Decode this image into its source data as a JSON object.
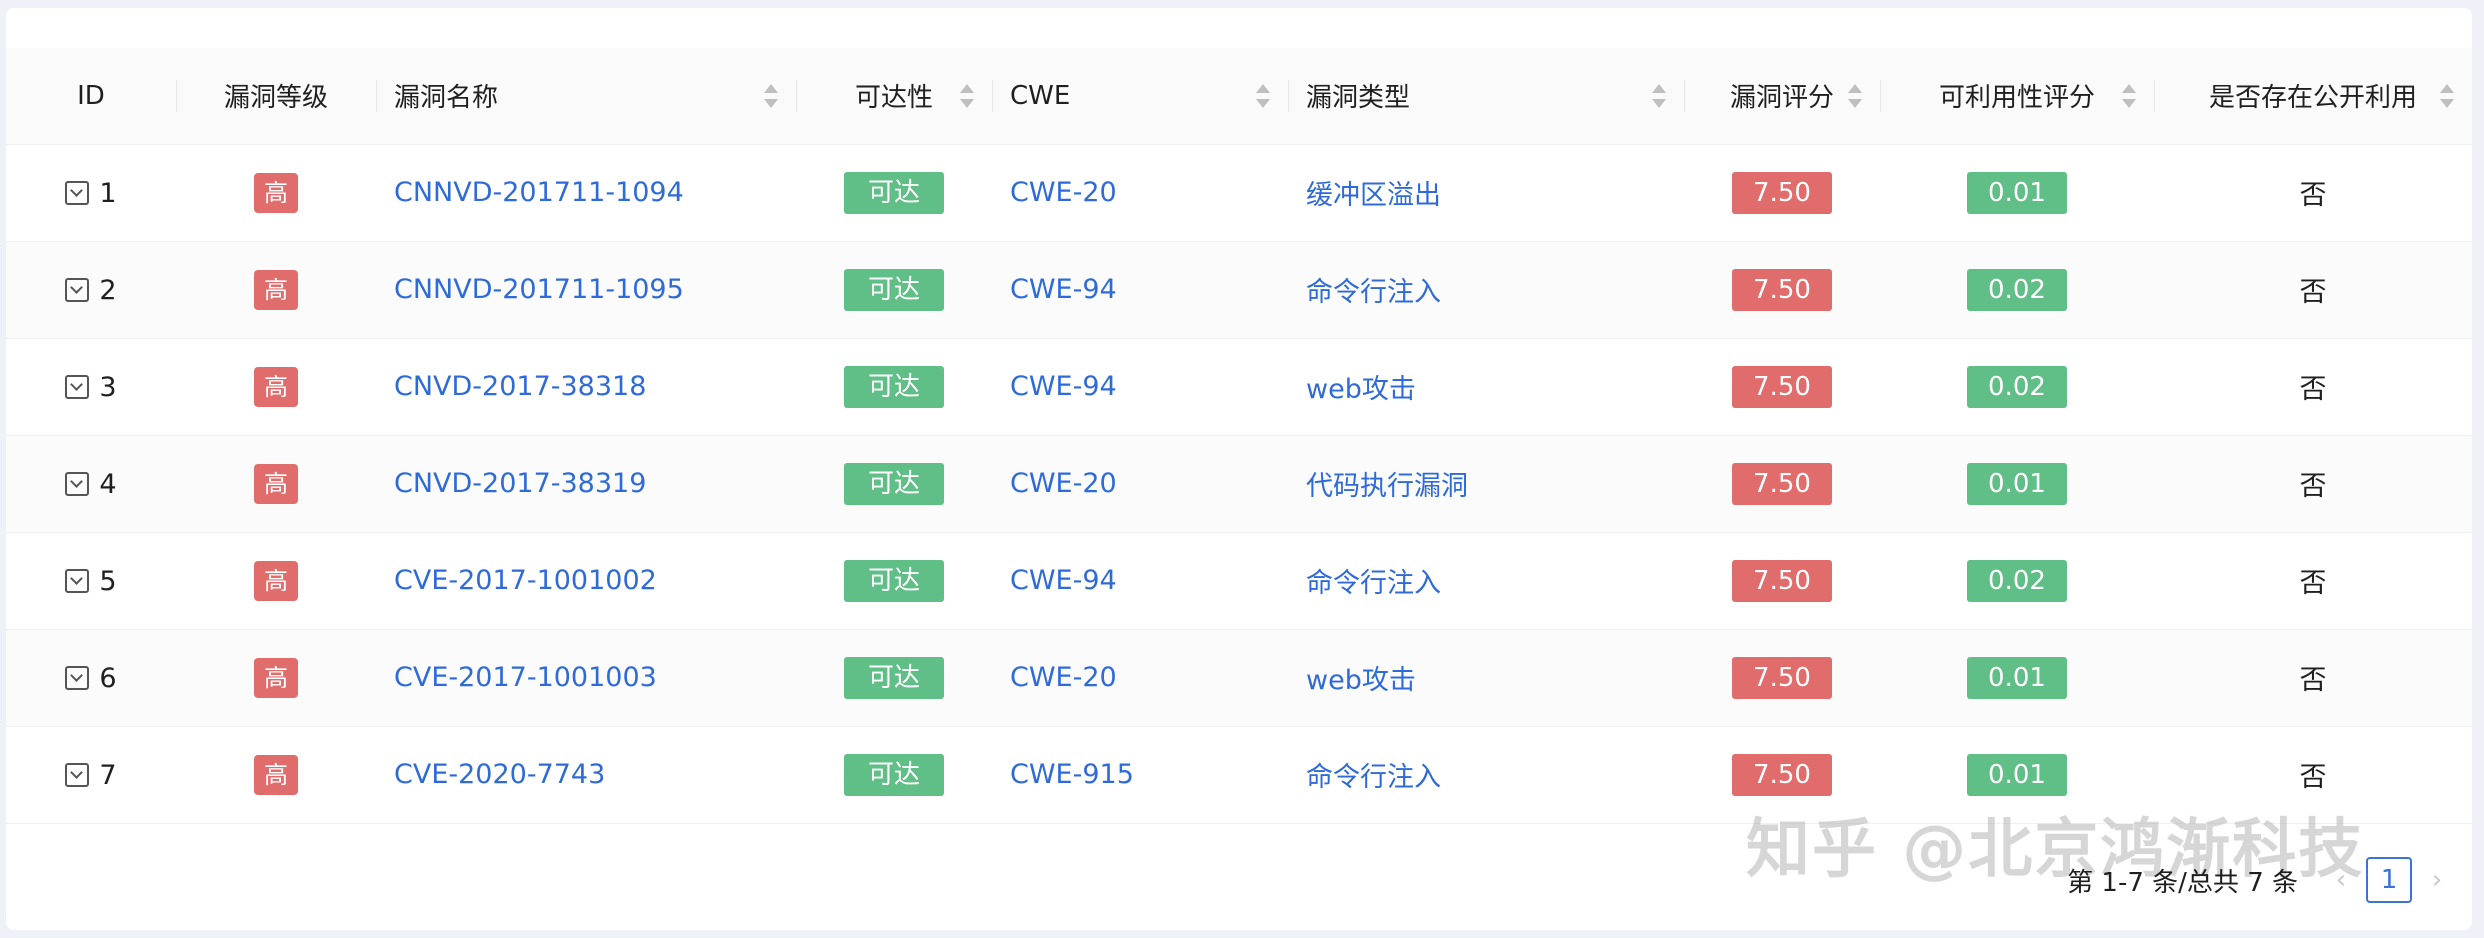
{
  "columns": {
    "id": "ID",
    "level": "漏洞等级",
    "name": "漏洞名称",
    "reach": "可达性",
    "cwe": "CWE",
    "type": "漏洞类型",
    "score": "漏洞评分",
    "exploit_score": "可利用性评分",
    "public": "是否存在公开利用"
  },
  "rows": [
    {
      "id": "1",
      "level": "高",
      "name": "CNNVD-201711-1094",
      "reach": "可达",
      "cwe": "CWE-20",
      "type": "缓冲区溢出",
      "score": "7.50",
      "exploit_score": "0.01",
      "public": "否"
    },
    {
      "id": "2",
      "level": "高",
      "name": "CNNVD-201711-1095",
      "reach": "可达",
      "cwe": "CWE-94",
      "type": "命令行注入",
      "score": "7.50",
      "exploit_score": "0.02",
      "public": "否"
    },
    {
      "id": "3",
      "level": "高",
      "name": "CNVD-2017-38318",
      "reach": "可达",
      "cwe": "CWE-94",
      "type": "web攻击",
      "score": "7.50",
      "exploit_score": "0.02",
      "public": "否"
    },
    {
      "id": "4",
      "level": "高",
      "name": "CNVD-2017-38319",
      "reach": "可达",
      "cwe": "CWE-20",
      "type": "代码执行漏洞",
      "score": "7.50",
      "exploit_score": "0.01",
      "public": "否"
    },
    {
      "id": "5",
      "level": "高",
      "name": "CVE-2017-1001002",
      "reach": "可达",
      "cwe": "CWE-94",
      "type": "命令行注入",
      "score": "7.50",
      "exploit_score": "0.02",
      "public": "否"
    },
    {
      "id": "6",
      "level": "高",
      "name": "CVE-2017-1001003",
      "reach": "可达",
      "cwe": "CWE-20",
      "type": "web攻击",
      "score": "7.50",
      "exploit_score": "0.01",
      "public": "否"
    },
    {
      "id": "7",
      "level": "高",
      "name": "CVE-2020-7743",
      "reach": "可达",
      "cwe": "CWE-915",
      "type": "命令行注入",
      "score": "7.50",
      "exploit_score": "0.01",
      "public": "否"
    }
  ],
  "pagination": {
    "total_text": "第 1-7 条/总共 7 条",
    "current_page": "1",
    "prev_icon": "‹",
    "next_icon": "›"
  },
  "watermark": "知乎 @北京鸿渐科技",
  "icons": {
    "expand": "expand-row-icon",
    "sort": "sort-caret-icon"
  },
  "colors": {
    "level_high": "#e06c6c",
    "reachable": "#5fbf86",
    "score": "#e06c6c",
    "exploit_score": "#5fbf86",
    "link": "#2f6bd8",
    "page_active": "#3b73d6"
  }
}
